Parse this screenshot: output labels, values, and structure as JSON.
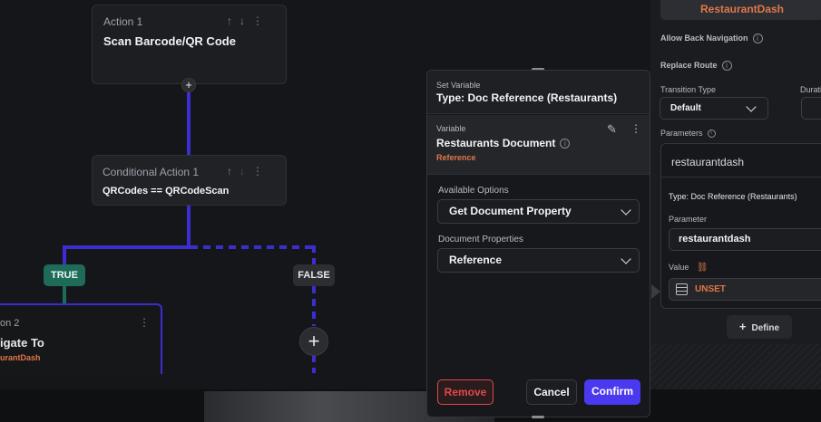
{
  "canvas": {
    "action1": {
      "label": "Action 1",
      "title": "Scan Barcode/QR Code"
    },
    "conditional": {
      "label": "Conditional Action 1",
      "expression": "QRCodes == QRCodeScan"
    },
    "true_label": "TRUE",
    "false_label": "FALSE",
    "action2": {
      "label": "on 2",
      "title": "igate To",
      "sub": "urantDash"
    },
    "add_symbol": "+"
  },
  "modal": {
    "header_label": "Set Variable",
    "header_title": "Type: Doc Reference (Restaurants)",
    "variable_label": "Variable",
    "variable_title": "Restaurants Document",
    "variable_type": "Reference",
    "available_options_label": "Available Options",
    "available_options_value": "Get Document Property",
    "doc_props_label": "Document Properties",
    "doc_props_value": "Reference",
    "remove_label": "Remove",
    "cancel_label": "Cancel",
    "confirm_label": "Confirm"
  },
  "panel": {
    "route_button": "RestaurantDash",
    "allow_back": "Allow Back Navigation",
    "replace_route": "Replace Route",
    "transition_type": "Transition Type",
    "duration": "Durati",
    "transition_value": "Default",
    "parameters": "Parameters",
    "param_name": "restaurantdash",
    "type_text": "Type: Doc Reference (Restaurants)",
    "parameter_label": "Parameter",
    "parameter_value": "restaurantdash",
    "value_label": "Value",
    "value_text": "UNSET",
    "define_label": "Define"
  },
  "colors": {
    "accent": "#3b2ed0",
    "true": "#1f6b5a",
    "confirm": "#4b39ef",
    "orange": "#e0774a",
    "remove": "#e0484a"
  }
}
